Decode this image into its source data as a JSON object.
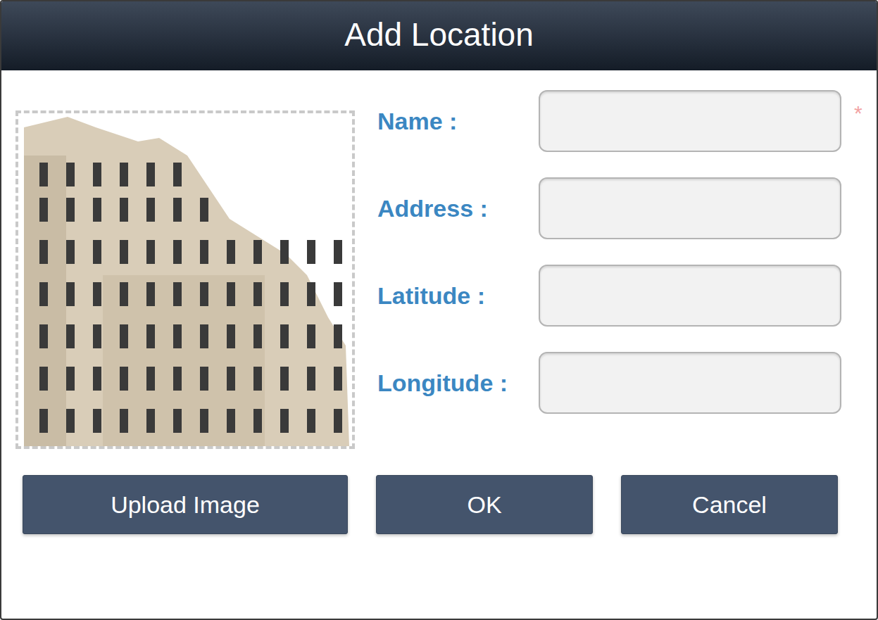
{
  "window": {
    "title": "Add Location"
  },
  "required_mark": "*",
  "fields": [
    {
      "label": "Name :",
      "required": true
    },
    {
      "label": "Address :",
      "required": false
    },
    {
      "label": "Latitude :",
      "required": false
    },
    {
      "label": "Longitude :",
      "required": false
    }
  ],
  "buttons": [
    "Upload Image",
    "OK",
    "Cancel"
  ]
}
